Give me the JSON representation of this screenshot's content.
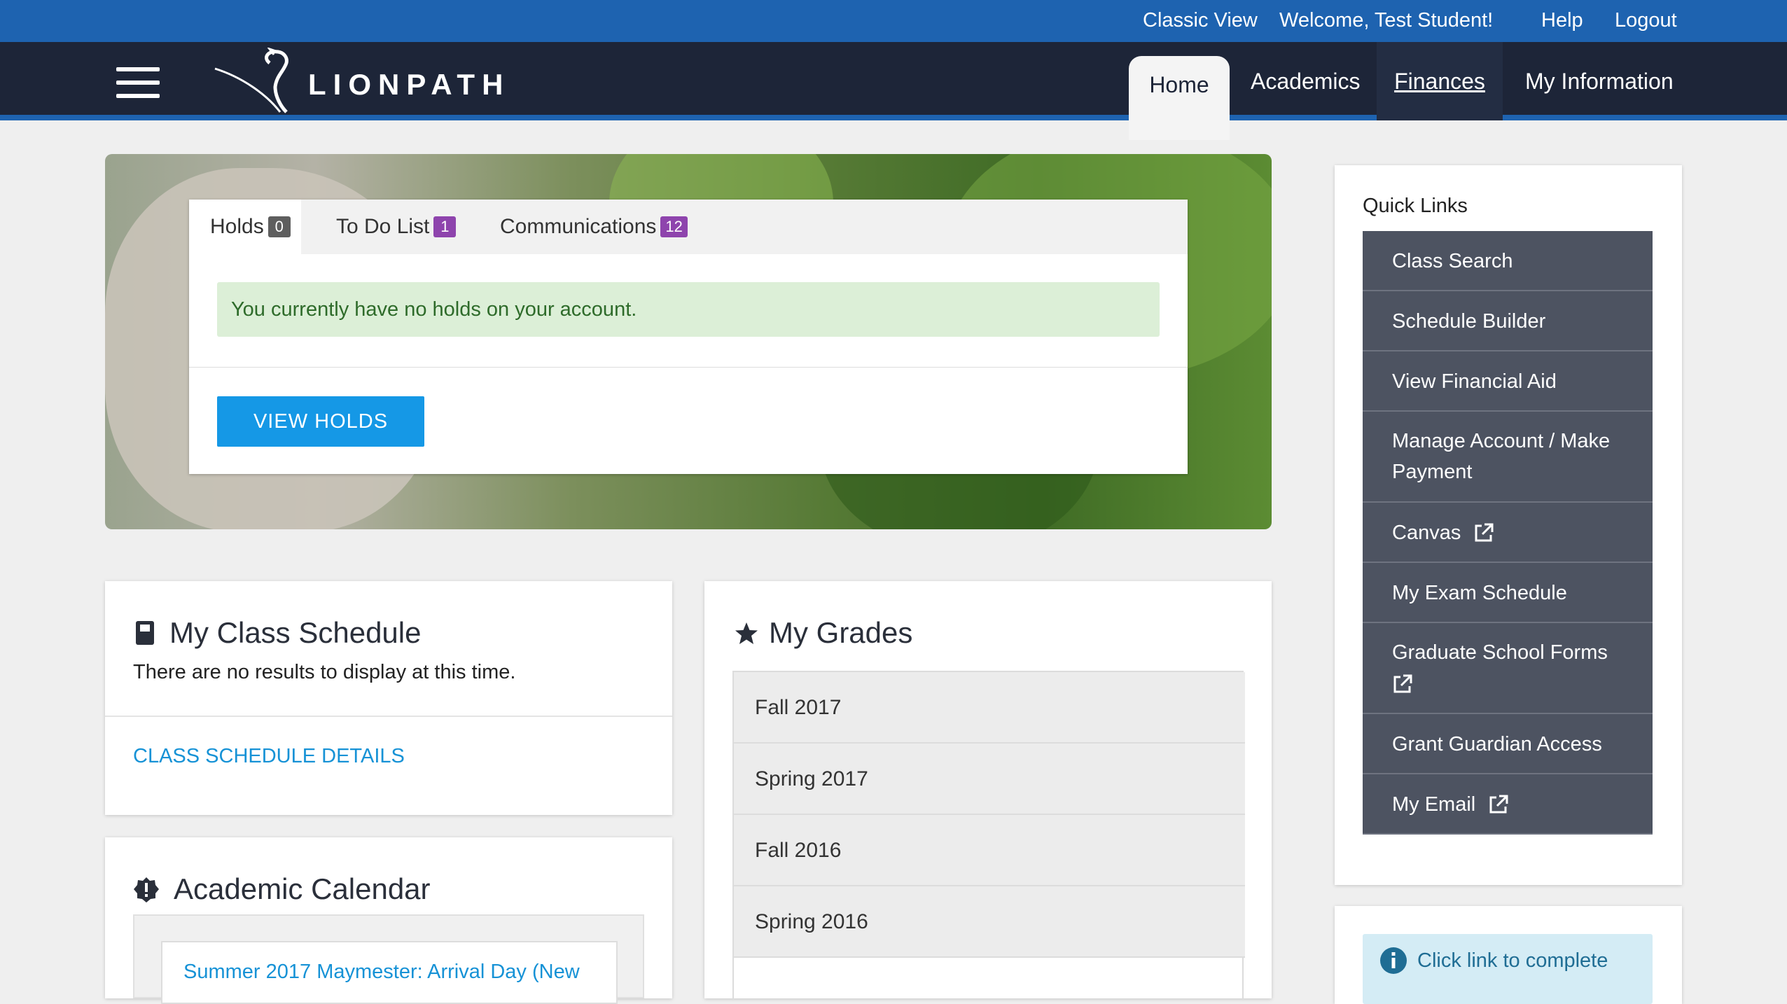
{
  "utility": {
    "classic_view": "Classic View",
    "welcome": "Welcome,  Test Student!",
    "help": "Help",
    "logout": "Logout"
  },
  "nav": {
    "logo_text": "LIONPATH",
    "tabs": [
      {
        "label": "Home",
        "active": true
      },
      {
        "label": "Academics"
      },
      {
        "label": "Finances",
        "hovered": true
      },
      {
        "label": "My Information"
      }
    ]
  },
  "holds": {
    "tabs": [
      {
        "label": "Holds",
        "count": "0",
        "badge_color": "#5e5e5e"
      },
      {
        "label": "To Do List",
        "count": "1",
        "badge_color": "#8e44ad"
      },
      {
        "label": "Communications",
        "count": "12",
        "badge_color": "#8e44ad"
      }
    ],
    "message": "You currently have no holds on your account.",
    "button": "VIEW HOLDS"
  },
  "class_schedule": {
    "title": "My Class Schedule",
    "icon": "book-icon",
    "empty_message": "There are no results to display at this time.",
    "link": "CLASS SCHEDULE DETAILS"
  },
  "academic_calendar": {
    "title": "Academic Calendar",
    "icon": "alert-badge-icon",
    "first_item": "Summer 2017 Maymester: Arrival Day (New"
  },
  "grades": {
    "title": "My Grades",
    "icon": "star-icon",
    "terms": [
      "Fall 2017",
      "Spring 2017",
      "Fall 2016",
      "Spring 2016"
    ]
  },
  "quick_links": {
    "title": "Quick Links",
    "items": [
      {
        "label": "Class Search",
        "external": false
      },
      {
        "label": "Schedule Builder",
        "external": false
      },
      {
        "label": "View Financial Aid",
        "external": false
      },
      {
        "label": "Manage Account / Make Payment",
        "external": false
      },
      {
        "label": "Canvas",
        "external": true
      },
      {
        "label": "My Exam Schedule",
        "external": false
      },
      {
        "label": "Graduate School Forms",
        "external": true
      },
      {
        "label": "Grant Guardian Access",
        "external": false
      },
      {
        "label": "My Email",
        "external": true
      }
    ]
  },
  "notice": {
    "icon": "info-icon",
    "text": "Click link to complete"
  },
  "colors": {
    "utility_bar": "#1e63b0",
    "nav_bar": "#1d2538",
    "quick_link_bg": "#4d5361",
    "button_blue": "#1598e6",
    "link_blue": "#1692d6",
    "alert_green_bg": "#dcefd7"
  }
}
